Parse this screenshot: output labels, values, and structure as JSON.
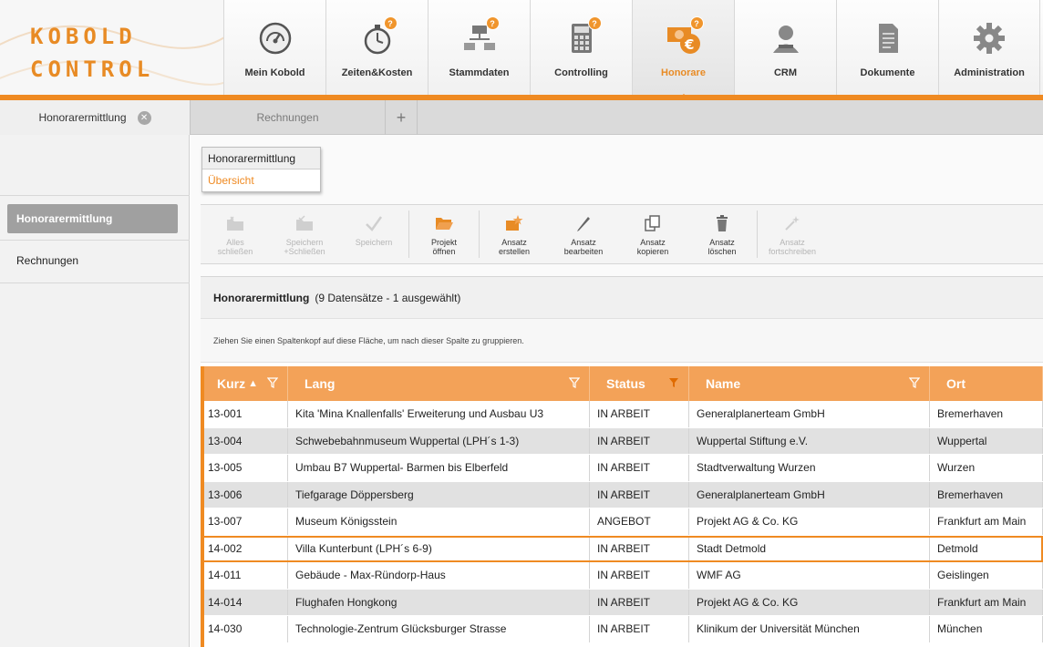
{
  "logo": {
    "line1": "KOBOLD",
    "line2": "CONTROL"
  },
  "nav": [
    {
      "label": "Mein Kobold",
      "icon": "dashboard-gauge-icon",
      "badge": ""
    },
    {
      "label": "Zeiten&Kosten",
      "icon": "stopwatch-icon",
      "badge": "?"
    },
    {
      "label": "Stammdaten",
      "icon": "hierarchy-icon",
      "badge": "?"
    },
    {
      "label": "Controlling",
      "icon": "calculator-icon",
      "badge": "?"
    },
    {
      "label": "Honorare",
      "icon": "money-euro-icon",
      "badge": "?",
      "active": true
    },
    {
      "label": "CRM",
      "icon": "contact-person-icon",
      "badge": ""
    },
    {
      "label": "Dokumente",
      "icon": "document-icon",
      "badge": ""
    },
    {
      "label": "Administration",
      "icon": "gear-icon",
      "badge": ""
    }
  ],
  "tabs": {
    "tab1": "Honorarermittlung",
    "tab2": "Rechnungen",
    "add": "+"
  },
  "sidebar": {
    "items": [
      "Honorarermittlung",
      "Rechnungen"
    ]
  },
  "breadcrumb": {
    "item1": "Honorarermittlung",
    "item2": "Übersicht"
  },
  "toolbar": {
    "alles_schliessen": "Alles\nschließen",
    "speichern_schliessen": "Speichern\n+Schließen",
    "speichern": "Speichern",
    "projekt_oeffnen": "Projekt\nöffnen",
    "ansatz_erstellen": "Ansatz\nerstellen",
    "ansatz_bearbeiten": "Ansatz\nbearbeiten",
    "ansatz_kopieren": "Ansatz\nkopieren",
    "ansatz_loeschen": "Ansatz\nlöschen",
    "ansatz_fortschreiben": "Ansatz\nfortschreiben"
  },
  "grid": {
    "title": "Honorarermittlung",
    "count": "(9 Datensätze - 1 ausgewählt)",
    "group_hint": "Ziehen Sie einen Spaltenkopf auf diese Fläche, um nach dieser Spalte zu gruppieren.",
    "columns": [
      "Kurz",
      "Lang",
      "Status",
      "Name",
      "Ort"
    ],
    "rows": [
      {
        "kurz": "13-001",
        "lang": "Kita 'Mina Knallenfalls' Erweiterung und Ausbau U3",
        "status": "IN ARBEIT",
        "name": "Generalplanerteam GmbH",
        "ort": "Bremerhaven"
      },
      {
        "kurz": "13-004",
        "lang": "Schwebebahnmuseum Wuppertal (LPH´s 1-3)",
        "status": "IN ARBEIT",
        "name": "Wuppertal Stiftung e.V.",
        "ort": "Wuppertal"
      },
      {
        "kurz": "13-005",
        "lang": "Umbau B7 Wuppertal- Barmen bis Elberfeld",
        "status": "IN ARBEIT",
        "name": "Stadtverwaltung Wurzen",
        "ort": "Wurzen"
      },
      {
        "kurz": "13-006",
        "lang": "Tiefgarage Döppersberg",
        "status": "IN ARBEIT",
        "name": "Generalplanerteam GmbH",
        "ort": "Bremerhaven"
      },
      {
        "kurz": "13-007",
        "lang": "Museum Königsstein",
        "status": "ANGEBOT",
        "name": "Projekt AG & Co. KG",
        "ort": "Frankfurt am Main"
      },
      {
        "kurz": "14-002",
        "lang": "Villa Kunterbunt (LPH´s 6-9)",
        "status": "IN ARBEIT",
        "name": "Stadt Detmold",
        "ort": "Detmold"
      },
      {
        "kurz": "14-011",
        "lang": "Gebäude - Max-Ründorp-Haus",
        "status": "IN ARBEIT",
        "name": "WMF AG",
        "ort": "Geislingen"
      },
      {
        "kurz": "14-014",
        "lang": "Flughafen Hongkong",
        "status": "IN ARBEIT",
        "name": "Projekt AG & Co. KG",
        "ort": "Frankfurt am Main"
      },
      {
        "kurz": "14-030",
        "lang": "Technologie-Zentrum Glücksburger Strasse",
        "status": "IN ARBEIT",
        "name": "Klinikum der Universität München",
        "ort": "München"
      }
    ]
  },
  "colors": {
    "accent": "#ef8a22",
    "header_bg": "#f3a258",
    "row_alt": "#e1e1e1"
  }
}
